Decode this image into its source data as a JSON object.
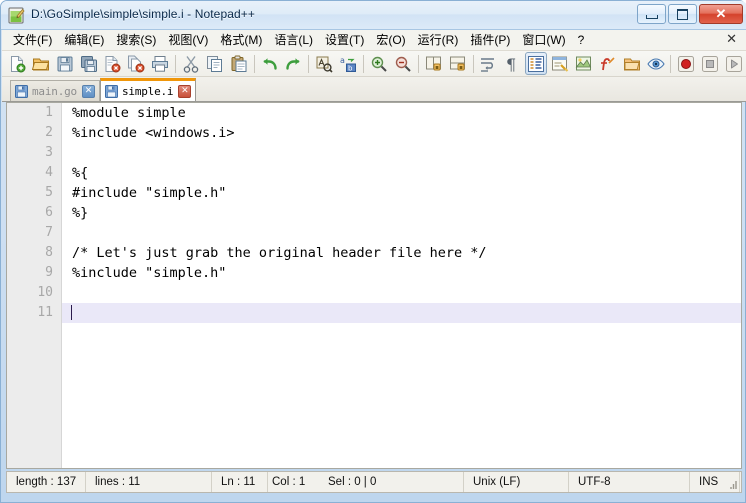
{
  "window": {
    "title": "D:\\GoSimple\\simple\\simple.i - Notepad++",
    "app_icon": "notepad-plus-plus-icon",
    "controls": {
      "minimize": "minimize-icon",
      "maximize": "maximize-icon",
      "close": "✕"
    },
    "frame_color": "#cfe0f2",
    "accent_color": "#f0960a"
  },
  "menubar": {
    "items": [
      {
        "label": "文件(F)",
        "name": "menu-file"
      },
      {
        "label": "编辑(E)",
        "name": "menu-edit"
      },
      {
        "label": "搜索(S)",
        "name": "menu-search"
      },
      {
        "label": "视图(V)",
        "name": "menu-view"
      },
      {
        "label": "格式(M)",
        "name": "menu-format"
      },
      {
        "label": "语言(L)",
        "name": "menu-language"
      },
      {
        "label": "设置(T)",
        "name": "menu-settings"
      },
      {
        "label": "宏(O)",
        "name": "menu-macro"
      },
      {
        "label": "运行(R)",
        "name": "menu-run"
      },
      {
        "label": "插件(P)",
        "name": "menu-plugins"
      },
      {
        "label": "窗口(W)",
        "name": "menu-window"
      },
      {
        "label": "?",
        "name": "menu-help"
      }
    ],
    "close_document": "✕"
  },
  "toolbar": {
    "buttons": [
      {
        "name": "new-file-icon",
        "title": "新建"
      },
      {
        "name": "open-file-icon",
        "title": "打开"
      },
      {
        "name": "save-icon",
        "title": "保存"
      },
      {
        "name": "save-all-icon",
        "title": "保存所有"
      },
      {
        "name": "close-file-icon",
        "title": "关闭"
      },
      {
        "name": "close-all-files-icon",
        "title": "关闭所有"
      },
      {
        "name": "print-icon",
        "title": "打印"
      },
      {
        "name": "separator",
        "title": ""
      },
      {
        "name": "cut-icon",
        "title": "剪切"
      },
      {
        "name": "copy-icon",
        "title": "复制"
      },
      {
        "name": "paste-icon",
        "title": "粘贴"
      },
      {
        "name": "separator",
        "title": ""
      },
      {
        "name": "undo-icon",
        "title": "撤销"
      },
      {
        "name": "redo-icon",
        "title": "重做"
      },
      {
        "name": "separator",
        "title": ""
      },
      {
        "name": "find-icon",
        "title": "查找"
      },
      {
        "name": "replace-icon",
        "title": "替换"
      },
      {
        "name": "separator",
        "title": ""
      },
      {
        "name": "zoom-in-icon",
        "title": "放大"
      },
      {
        "name": "zoom-out-icon",
        "title": "缩小"
      },
      {
        "name": "separator",
        "title": ""
      },
      {
        "name": "sync-vertical-scroll-icon",
        "title": "同步垂直滚动"
      },
      {
        "name": "sync-horizontal-scroll-icon",
        "title": "同步水平滚动"
      },
      {
        "name": "separator",
        "title": ""
      },
      {
        "name": "word-wrap-icon",
        "title": "自动换行"
      },
      {
        "name": "show-all-characters-icon",
        "title": "显示所有字符"
      },
      {
        "name": "indent-guide-icon",
        "title": "显示缩进参考线",
        "active": true
      },
      {
        "name": "user-defined-language-icon",
        "title": "用户自定义语言"
      },
      {
        "name": "document-map-icon",
        "title": "文档地图"
      },
      {
        "name": "function-list-icon",
        "title": "函数列表"
      },
      {
        "name": "folder-as-workspace-icon",
        "title": "文件夹作为工作区"
      },
      {
        "name": "monitoring-icon",
        "title": "监视文件"
      },
      {
        "name": "separator",
        "title": ""
      },
      {
        "name": "record-macro-icon",
        "title": "录制宏"
      },
      {
        "name": "stop-macro-icon",
        "title": "停止录制"
      },
      {
        "name": "play-macro-icon",
        "title": "播放宏"
      }
    ]
  },
  "tabs": [
    {
      "label": "main.go",
      "active": false,
      "close": "✕",
      "icon": "saved-file-icon"
    },
    {
      "label": "simple.i",
      "active": true,
      "close": "✕",
      "icon": "saved-file-icon"
    }
  ],
  "editor": {
    "line_numbers": [
      "1",
      "2",
      "3",
      "4",
      "5",
      "6",
      "7",
      "8",
      "9",
      "10",
      "11"
    ],
    "lines": [
      "%module simple",
      "%include <windows.i>",
      "",
      "%{",
      "#include \"simple.h\"",
      "%}",
      "",
      "/* Let's just grab the original header file here */",
      "%include \"simple.h\"",
      "",
      ""
    ],
    "current_line": 11,
    "current_line_color": "#eae8f8",
    "text_color": "#000000",
    "gutter_color": "#ececec"
  },
  "statusbar": {
    "length_label": "length : 137",
    "lines_label": "lines : 11",
    "ln_label": "Ln : 11",
    "col_label": "Col : 1",
    "sel_label": "Sel : 0 | 0",
    "eol": "Unix (LF)",
    "encoding": "UTF-8",
    "insert_mode": "INS"
  }
}
